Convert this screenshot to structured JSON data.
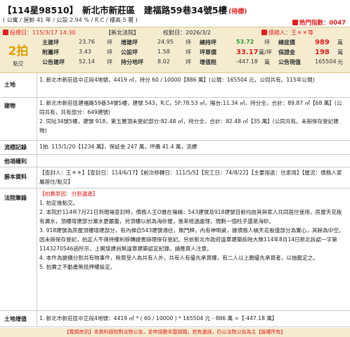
{
  "header": {
    "case_no": "【114星98510】",
    "address": "新北市新莊區　建福路59巷34號5樓",
    "status": "(待標)",
    "sub": "( 公寓 / 屋齡 41 年 / 公設 2.94 % / R.C / 樓高 5 層 )",
    "hot_label": "熱門指數：",
    "hot_value": "0047"
  },
  "info": {
    "bid_date": "投標日：115/3/17 14:30",
    "court": "【新北法院】",
    "check_date": "校對日：2026/3/2",
    "creditor": "債務人：王＊＊等",
    "auction_round": "2拍",
    "auction_type": "點交",
    "rows": [
      {
        "k1": "主建坪",
        "v1": "23.76",
        "u1": "坪",
        "k2": "增建坪",
        "v2": "24.95",
        "u2": "坪",
        "k3": "總持坪",
        "v3": "53.72",
        "u3": "坪",
        "k4": "總底價",
        "v4": "989",
        "u4": "萬"
      },
      {
        "k1": "附屬坪",
        "v1": "3.43",
        "u1": "坪",
        "k2": "公設坪",
        "v2": "1.58",
        "u2": "坪",
        "k3": "坪單價",
        "v3": "33.17",
        "u3": "萬/坪",
        "k4": "保證金",
        "v4": "198",
        "u4": "萬"
      },
      {
        "k1": "公告建坪",
        "v1": "52.14",
        "u1": "坪",
        "k2": "持分地坪",
        "v2": "8.02",
        "u2": "坪",
        "k3": "增值稅",
        "v3": "-447.18",
        "u3": "萬",
        "k4": "公告現值",
        "v4": "165504",
        "u4": "元"
      }
    ]
  },
  "sections": {
    "land": {
      "label": "土地",
      "lines": [
        "1. 新北市新莊區中正段4地號，4419 ㎡，持分 60 / 10000【886 萬】(公現：165504 元，公同共有。115年公現)"
      ]
    },
    "building": {
      "label": "建物",
      "lines": [
        "1. 新北市新莊區建福路59巷34號5樓，建號 543，R.C，5F:78.53 ㎡，陽台:11.34 ㎡，持分全，合計：89.87 ㎡【68 萬】(公同共有，共有部分：649建號)",
        "2. 同址34號5樓，建號 918，第五層頂未登記部分:82.48 ㎡，持分全，合計：82.48 ㎡【35 萬】(公同共有。未辦保存登記建物)"
      ]
    },
    "record": {
      "label": "流標記錄",
      "text": "1拍. 115/1/20【1234 萬】，保証金 247 萬，坪價 41.4 萬，流標"
    },
    "other": {
      "label": "他項權利",
      "text": ""
    },
    "survey": {
      "label": "勝本資料",
      "text": "【查封人：王＊＊】【查封日：114/6/17】【前次移轉日：111/5/5】【完工日：74/8/22】【主要用途：住家用】【屋況：債務人家屬居住/點交】"
    },
    "legal": {
      "label": "法院筆錄",
      "title": "【拍賣原因：分割遺產】",
      "items": [
        "1. 拍定後點交。",
        "2. 本院於114年7月21日到現場查封時，債務人王O雅在場稱：543建號及918建號目前均由其與家人共同居住使用，房屋天花板有漏水，頂樓增建部分漏水更嚴重，另頂樓以前為海砂屋，後來經過處理，現剩一個柱子還是海砂。",
        "3. 918建號為房屋頂樓增建部分，有內梯自543建號通往，無門牌，內有神明桌，據債務人稱天花板僅部分為實心，其餘為中空。因未辦保存登記，拍定人不得持權利移轉證書辦理保存登記。另依新北市政府違章建築拆除大隊114年8月14日新北拆認一字第1143270546函所示，上開增建尚無違章建築認定紀錄。請應買人注意。",
        "4. 本件為變價分割共有物事件，除買受人為共有人外，共有人有優先承買權，有二人以上願優先承買者，以抽籤定之。",
        "5. 拍賣之不動產無抵押權設定。"
      ]
    },
    "tax": {
      "label": "土地增值",
      "text": "1. 新北市新莊區中正段4地號：4419 ㎡ * ( 60 / 10000 ) * 165504 元 - 886 萬 =【-447.18 萬】"
    }
  },
  "footer": "【寬頻房訊】本資料經校對法院公告，並申請謄本暨調閱，若有遺誤，仍以法院公告為主【版權所有】"
}
